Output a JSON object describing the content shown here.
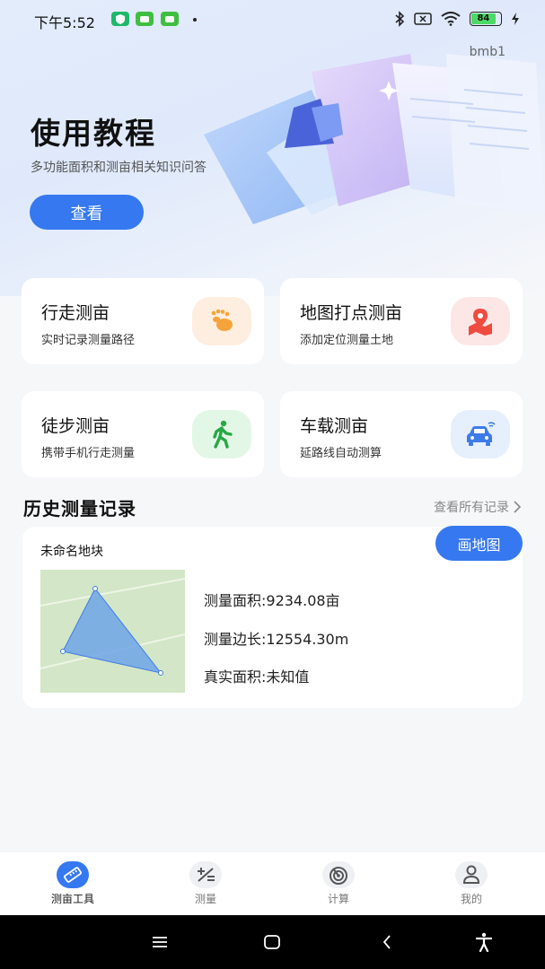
{
  "status_bar": {
    "time": "下午5:52",
    "battery": "84",
    "app_icons": [
      "shield-app-icon",
      "android-app-icon",
      "android-app-icon"
    ],
    "right_icons": [
      "bluetooth-icon",
      "sim-x-icon",
      "wifi-icon",
      "battery-icon",
      "charging-icon"
    ]
  },
  "header": {
    "user": "bmb1"
  },
  "hero": {
    "title": "使用教程",
    "subtitle": "多功能面积和测亩相关知识问答",
    "button": "查看"
  },
  "cards": [
    {
      "title": "行走测亩",
      "subtitle": "实时记录测量路径",
      "icon": "footprints-icon",
      "icon_bg": "#fdeee0",
      "icon_color": "#f5a43b"
    },
    {
      "title": "地图打点测亩",
      "subtitle": "添加定位测量土地",
      "icon": "map-pin-icon",
      "icon_bg": "#fde7e6",
      "icon_color": "#ef4b3f"
    },
    {
      "title": "徒步测亩",
      "subtitle": "携带手机行走测量",
      "icon": "walking-person-icon",
      "icon_bg": "#e3f7e6",
      "icon_color": "#27a844"
    },
    {
      "title": "车载测亩",
      "subtitle": "延路线自动测算",
      "icon": "car-icon",
      "icon_bg": "#e6effc",
      "icon_color": "#3d7be8"
    }
  ],
  "history": {
    "title": "历史测量记录",
    "view_all": "查看所有记录",
    "record": {
      "name": "未命名地块",
      "draw_button": "画地图",
      "area_label": "测量面积:9234.08亩",
      "perimeter_label": "测量边长:12554.30m",
      "real_area_label": "真实面积:未知值"
    }
  },
  "bottom_nav": [
    {
      "label": "测亩工具",
      "icon": "ruler-icon",
      "active": true
    },
    {
      "label": "测量",
      "icon": "plus-minus-icon",
      "active": false
    },
    {
      "label": "计算",
      "icon": "radar-icon",
      "active": false
    },
    {
      "label": "我的",
      "icon": "user-icon",
      "active": false
    }
  ],
  "colors": {
    "accent": "#3578f0",
    "background": "#f6f7f9"
  }
}
